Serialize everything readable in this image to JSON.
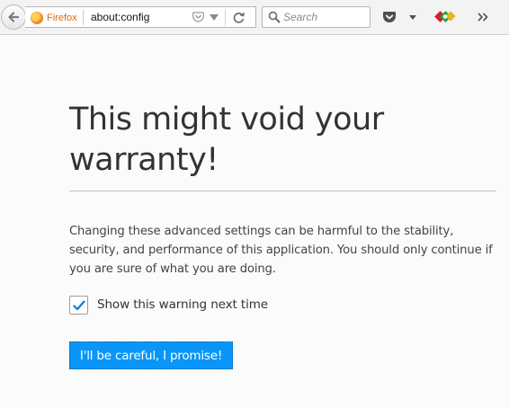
{
  "browser": {
    "brand": "Firefox",
    "url": "about:config",
    "search_placeholder": "Search"
  },
  "page": {
    "title": "This might void your warranty!",
    "description": "Changing these advanced settings can be harmful to the stability, security, and performance of this application. You should only continue if you are sure of what you are doing.",
    "checkbox": {
      "label": "Show this warning next time",
      "checked": true
    },
    "button_label": "I'll be careful, I promise!"
  },
  "colors": {
    "accent": "#0996f8",
    "brand_text": "#d86a1a"
  }
}
